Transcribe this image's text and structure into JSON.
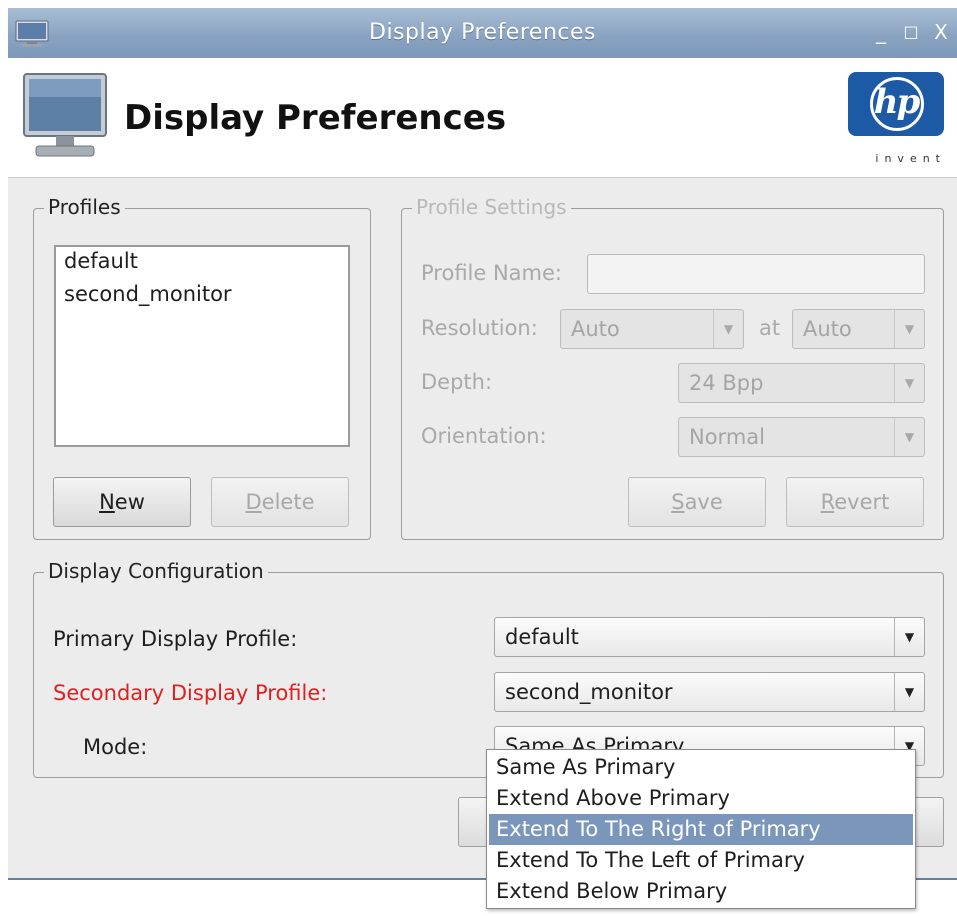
{
  "window": {
    "title": "Display Preferences",
    "controls": {
      "minimize": "_",
      "maximize": "□",
      "close": "X"
    }
  },
  "header": {
    "title": "Display Preferences",
    "logo": {
      "mark": "hp",
      "tagline": "invent",
      "color": "#1d5aa6"
    }
  },
  "profiles": {
    "legend": "Profiles",
    "items": [
      "default",
      "second_monitor"
    ],
    "new_button": {
      "mnemonic": "N",
      "rest": "ew"
    },
    "delete_button": {
      "mnemonic": "D",
      "rest": "elete",
      "enabled": false
    }
  },
  "profile_settings": {
    "legend": "Profile Settings",
    "enabled": false,
    "profile_name_label": "Profile Name:",
    "profile_name_value": "",
    "resolution_label": "Resolution:",
    "resolution_value": "Auto",
    "at_label": "at",
    "rate_value": "Auto",
    "depth_label": "Depth:",
    "depth_value": "24 Bpp",
    "orientation_label": "Orientation:",
    "orientation_value": "Normal",
    "save_button": {
      "mnemonic": "S",
      "rest": "ave"
    },
    "revert_button": {
      "mnemonic": "R",
      "rest": "evert"
    }
  },
  "display_configuration": {
    "legend": "Display Configuration",
    "primary_label": "Primary Display Profile:",
    "primary_value": "default",
    "secondary_label": "Secondary Display Profile:",
    "secondary_label_color": "#e02020",
    "secondary_value": "second_monitor",
    "mode_label": "Mode:",
    "mode_value": "Same As Primary",
    "mode_options": [
      "Same As Primary",
      "Extend Above Primary",
      "Extend To The Right of Primary",
      "Extend To The Left of Primary",
      "Extend Below Primary"
    ],
    "highlighted_option": "Extend To The Right of Primary"
  },
  "colors": {
    "titlebar": "#8aa3c1",
    "selection": "#7a96bb",
    "window_bg": "#ececec"
  }
}
